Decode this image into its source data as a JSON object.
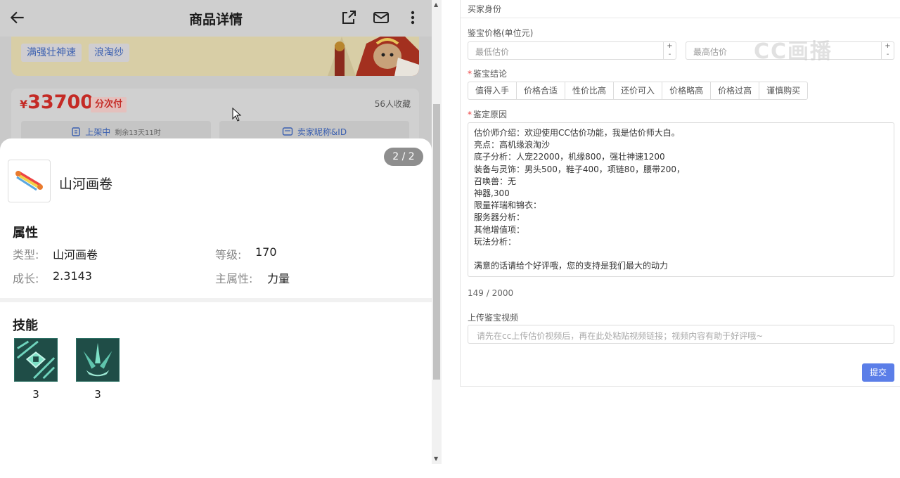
{
  "phone": {
    "title": "商品详情",
    "tags": [
      "满强壮神速",
      "浪淘纱"
    ],
    "price_currency": "¥",
    "price_value": "33700",
    "pay_tag": "分次付",
    "favorites": "56人收藏",
    "listing_status": "上架中",
    "listing_remaining": "剩余13天11时",
    "seller_info": "卖家昵称&ID",
    "sheet": {
      "pager": "2 / 2",
      "item_name": "山河画卷",
      "attributes_title": "属性",
      "attributes": [
        {
          "key": "类型:",
          "value": "山河画卷"
        },
        {
          "key": "等级:",
          "value": "170"
        },
        {
          "key": "成长:",
          "value": "2.3143"
        },
        {
          "key": "主属性:",
          "value": "力量"
        }
      ],
      "skills_title": "技能",
      "skills": [
        {
          "icon": "skill-crest-icon",
          "count": "3"
        },
        {
          "icon": "skill-blades-icon",
          "count": "3"
        }
      ]
    }
  },
  "form": {
    "header": "买家身份",
    "price_label": "鉴宝价格(单位元)",
    "min_placeholder": "最低估价",
    "max_placeholder": "最高估价",
    "conclusion_label": "鉴宝结论",
    "conclusion_options": [
      "值得入手",
      "价格合适",
      "性价比高",
      "还价可入",
      "价格略高",
      "价格过高",
      "谨慎购买"
    ],
    "reason_label": "鉴定原因",
    "reason_lines": [
      "估价师介绍：欢迎使用CC估价功能，我是估价师大白。",
      "亮点：高机缘浪淘沙",
      "底子分析：人宠22000，机缘800，强壮神速1200",
      "装备与灵饰：男头500，鞋子400，项链80，腰带200，",
      "召唤兽：无",
      "神器,300",
      "限量祥瑞和锦衣：",
      "服务器分析：",
      "其他增值项：",
      "玩法分析：",
      "",
      "满意的话请给个好评哦，您的支持是我们最大的动力"
    ],
    "char_count": "149 / 2000",
    "video_label": "上传鉴宝视频",
    "video_placeholder": "请先在cc上传估价视频后，再在此处粘贴视频链接；视频内容有助于好评哦~",
    "submit_label": "提交",
    "watermark": "CC画播"
  },
  "colors": {
    "price_red": "#c42a25",
    "tag_blue": "#3a5fb0",
    "submit_blue": "#5b7ee8",
    "required_red": "#e44444"
  }
}
